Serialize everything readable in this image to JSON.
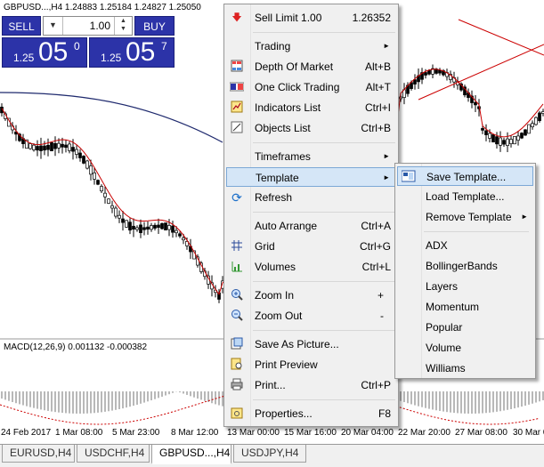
{
  "chart": {
    "symbol_line": "GBPUSD...,H4  1.24883 1.25184 1.24827 1.25050",
    "macd_line": "MACD(12,26,9) 0.001132 -0.000382",
    "time_labels": [
      "24 Feb 2017",
      "1 Mar 08:00",
      "5 Mar 23:00",
      "8 Mar 12:00",
      "13 Mar 00:00",
      "15 Mar 16:00",
      "20 Mar 04:00",
      "22 Mar 20:00",
      "27 Mar 08:00",
      "30 Mar 0"
    ]
  },
  "one_click": {
    "sell_label": "SELL",
    "buy_label": "BUY",
    "volume": "1.00",
    "sell_prefix": "1.25",
    "sell_big": "05",
    "sell_sup": "0",
    "buy_prefix": "1.25",
    "buy_big": "05",
    "buy_sup": "7"
  },
  "context_menu": {
    "items": [
      {
        "label": "Sell Limit 1.00",
        "shortcut": "1.26352",
        "icon": "sell-limit-icon"
      },
      {
        "label": "Trading",
        "shortcut": "",
        "icon": ""
      },
      {
        "label": "Depth Of Market",
        "shortcut": "Alt+B",
        "icon": "depth-of-market-icon"
      },
      {
        "label": "One Click Trading",
        "shortcut": "Alt+T",
        "icon": "one-click-trading-icon"
      },
      {
        "label": "Indicators List",
        "shortcut": "Ctrl+I",
        "icon": "indicators-list-icon"
      },
      {
        "label": "Objects List",
        "shortcut": "Ctrl+B",
        "icon": "objects-list-icon"
      },
      {
        "label": "Timeframes",
        "shortcut": "",
        "icon": ""
      },
      {
        "label": "Template",
        "shortcut": "",
        "icon": ""
      },
      {
        "label": "Refresh",
        "shortcut": "",
        "icon": "refresh-icon"
      },
      {
        "label": "Auto Arrange",
        "shortcut": "Ctrl+A",
        "icon": ""
      },
      {
        "label": "Grid",
        "shortcut": "Ctrl+G",
        "icon": "grid-icon"
      },
      {
        "label": "Volumes",
        "shortcut": "Ctrl+L",
        "icon": "volumes-icon"
      },
      {
        "label": "Zoom In",
        "shortcut": "+",
        "icon": "zoom-in-icon"
      },
      {
        "label": "Zoom Out",
        "shortcut": "-",
        "icon": "zoom-out-icon"
      },
      {
        "label": "Save As Picture...",
        "shortcut": "",
        "icon": "save-picture-icon"
      },
      {
        "label": "Print Preview",
        "shortcut": "",
        "icon": "print-preview-icon"
      },
      {
        "label": "Print...",
        "shortcut": "Ctrl+P",
        "icon": "print-icon"
      },
      {
        "label": "Properties...",
        "shortcut": "F8",
        "icon": "properties-icon"
      }
    ]
  },
  "template_submenu": {
    "items": [
      {
        "label": "Save Template...",
        "icon": "save-template-icon"
      },
      {
        "label": "Load Template..."
      },
      {
        "label": "Remove Template"
      },
      {
        "label": "ADX"
      },
      {
        "label": "BollingerBands"
      },
      {
        "label": "Layers"
      },
      {
        "label": "Momentum"
      },
      {
        "label": "Popular"
      },
      {
        "label": "Volume"
      },
      {
        "label": "Williams"
      }
    ]
  },
  "tabs": [
    "EURUSD,H4",
    "USDCHF,H4",
    "GBPUSD...,H4",
    "USDJPY,H4"
  ],
  "colors": {
    "accent_blue": "#2c33a8",
    "highlight": "#d5e6f7",
    "ma_red": "#c80000",
    "ma_navy": "#1f2a6e",
    "macd_gray": "#b8b8b8"
  }
}
